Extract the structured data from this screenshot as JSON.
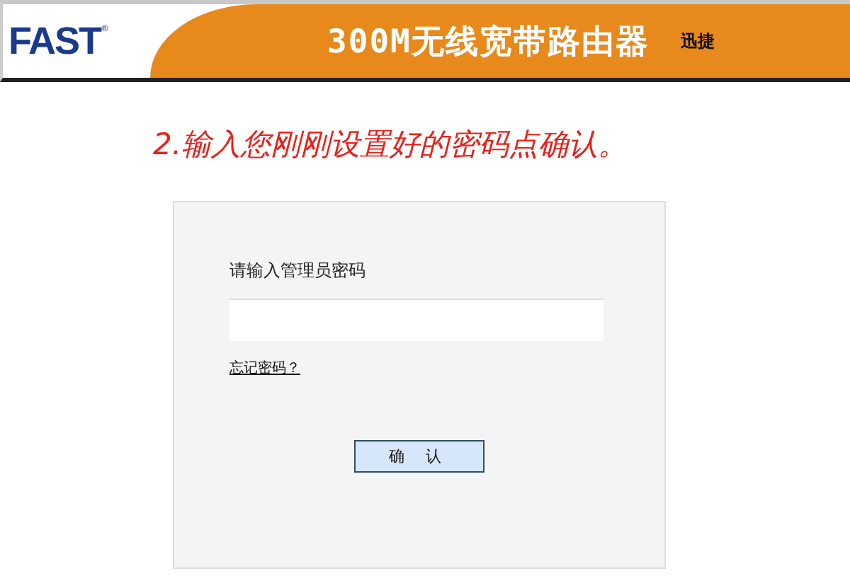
{
  "header": {
    "logo": "FAST",
    "logo_mark": "®",
    "title": "300M无线宽带路由器",
    "brand": "迅捷"
  },
  "instruction": "2.输入您刚刚设置好的密码点确认。",
  "login": {
    "label": "请输入管理员密码",
    "forgot_link": "忘记密码？",
    "confirm_button": "确 认"
  }
}
